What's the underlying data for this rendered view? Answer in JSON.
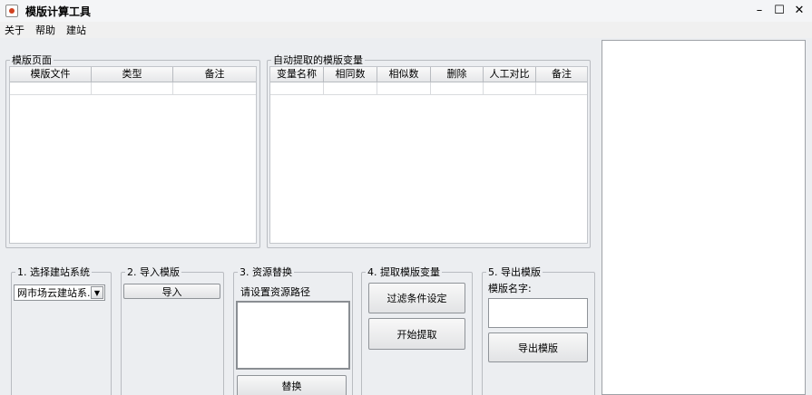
{
  "window": {
    "title": "模版计算工具",
    "minimize_glyph": "–",
    "maximize_glyph": "☐",
    "close_glyph": "✕"
  },
  "menu": {
    "items": [
      "关于",
      "帮助",
      "建站"
    ]
  },
  "template_page": {
    "legend": "模版页面",
    "columns": [
      "模版文件",
      "类型",
      "备注"
    ]
  },
  "extracted_vars": {
    "legend": "自动提取的模版变量",
    "columns": [
      "变量名称",
      "相同数",
      "相似数",
      "删除",
      "人工对比",
      "备注"
    ]
  },
  "step1": {
    "legend": "1. 选择建站系统",
    "selected": "网市场云建站系...",
    "arrow_glyph": "▼"
  },
  "step2": {
    "legend": "2. 导入模版",
    "button": "导入"
  },
  "step3": {
    "legend": "3. 资源替换",
    "label": "请设置资源路径",
    "button": "替换"
  },
  "step4": {
    "legend": "4. 提取模版变量",
    "filter_button": "过滤条件设定",
    "start_button": "开始提取"
  },
  "step5": {
    "legend": "5. 导出模版",
    "label": "模版名字:",
    "button": "导出模版"
  }
}
